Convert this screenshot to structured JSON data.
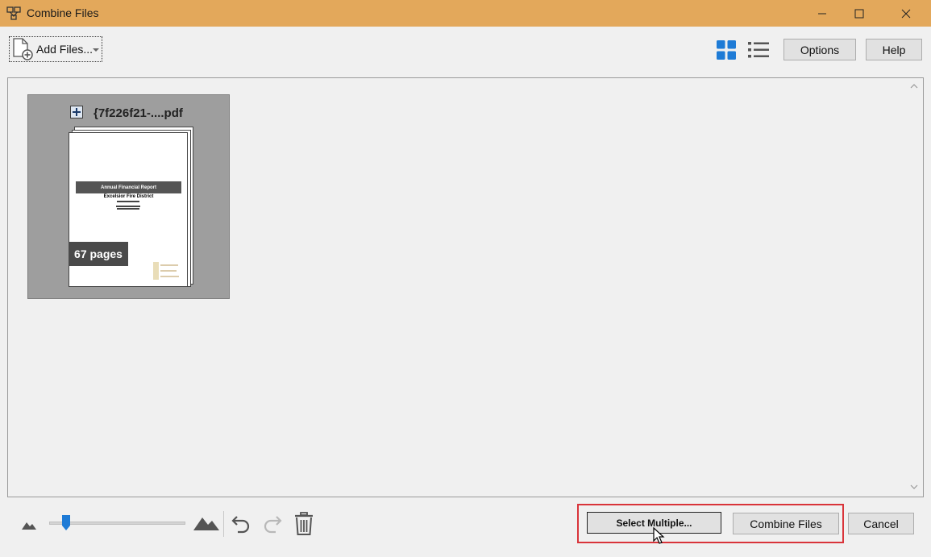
{
  "window": {
    "title": "Combine Files"
  },
  "toolbar": {
    "add_files_label": "Add Files...",
    "options_label": "Options",
    "help_label": "Help"
  },
  "file": {
    "name": "{7f226f21-....pdf",
    "pages_label": "67 pages",
    "thumbnail": {
      "band_title": "Annual Financial Report",
      "district": "Excelsior Fire District"
    }
  },
  "footer": {
    "select_multiple_label": "Select Multiple...",
    "combine_label": "Combine Files",
    "cancel_label": "Cancel"
  },
  "zoom": {
    "level_fraction": 0.1
  },
  "colors": {
    "titlebar": "#e3a85b",
    "accent_blue": "#1e7bd6",
    "highlight_red": "#d9343a",
    "card_gray": "#9e9e9e"
  }
}
